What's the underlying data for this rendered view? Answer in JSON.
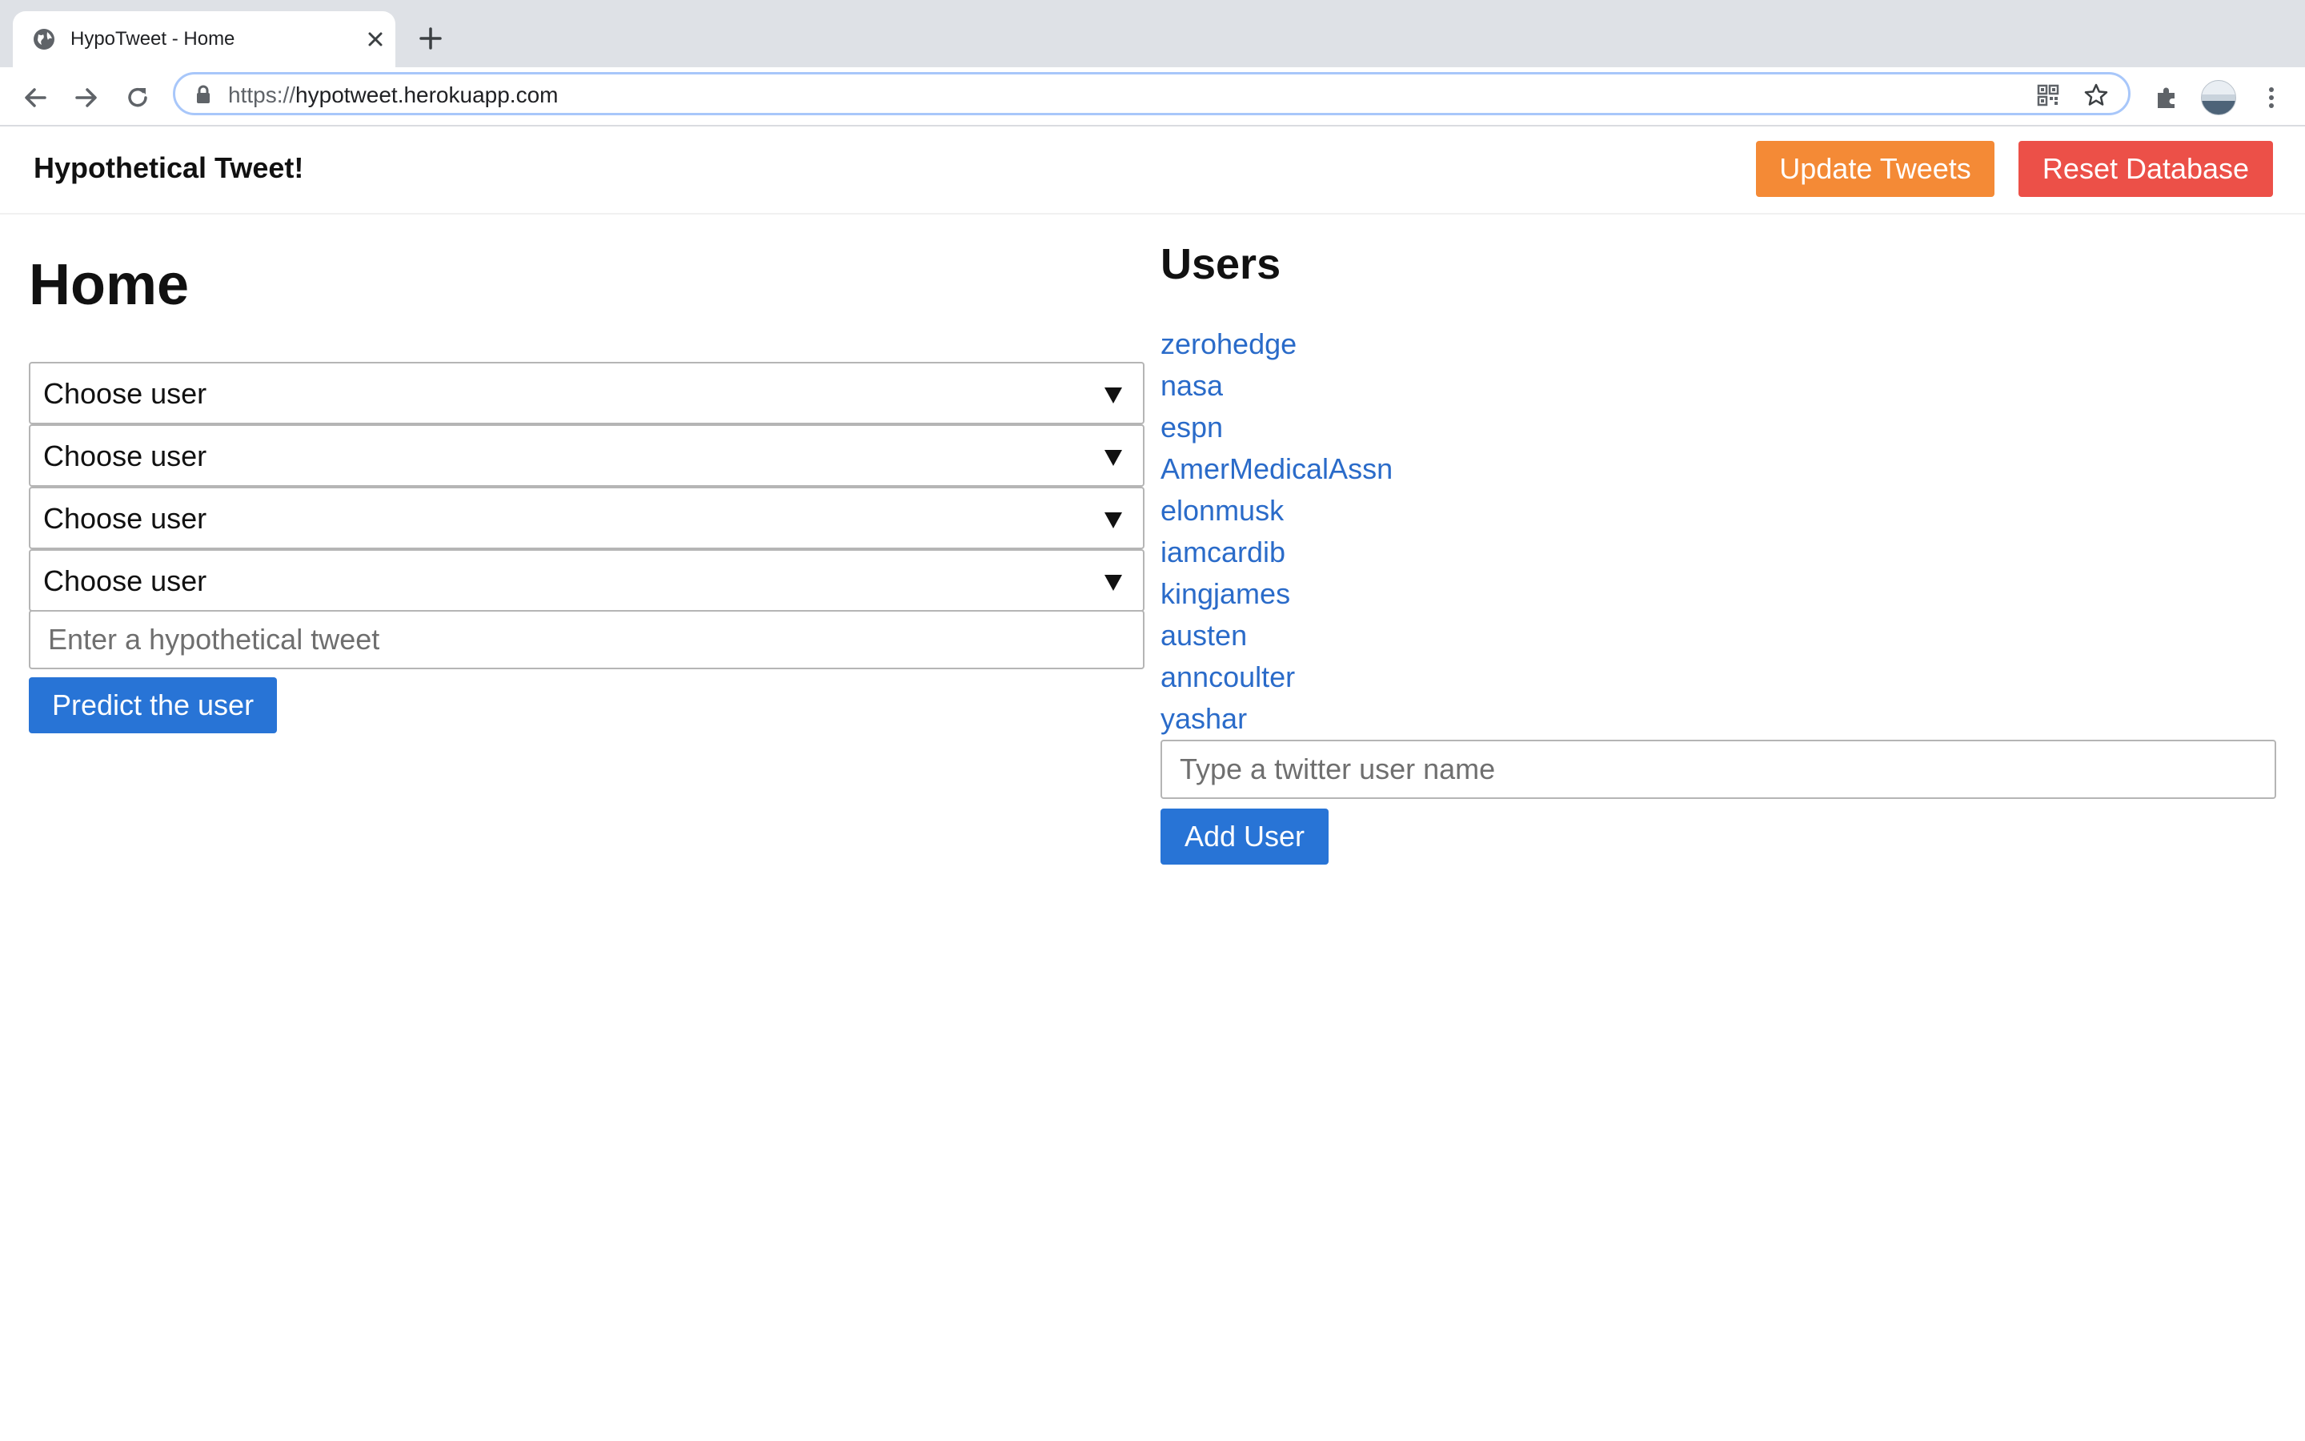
{
  "browser": {
    "tab_title": "HypoTweet - Home",
    "url_scheme": "https://",
    "url_host": "hypotweet.herokuapp.com",
    "icons": [
      "globe-icon",
      "close-icon",
      "plus-icon",
      "back-arrow-icon",
      "forward-arrow-icon",
      "reload-icon",
      "lock-icon",
      "qr-code-icon",
      "star-icon",
      "puzzle-icon",
      "kebab-menu-icon"
    ]
  },
  "navbar": {
    "brand": "Hypothetical Tweet!",
    "update_label": "Update Tweets",
    "reset_label": "Reset Database",
    "colors": {
      "update": "#f48a36",
      "reset": "#ec5048"
    }
  },
  "home": {
    "title": "Home",
    "selects": [
      {
        "value": "Choose user"
      },
      {
        "value": "Choose user"
      },
      {
        "value": "Choose user"
      },
      {
        "value": "Choose user"
      }
    ],
    "tweet_placeholder": "Enter a hypothetical tweet",
    "predict_label": "Predict the user"
  },
  "users": {
    "title": "Users",
    "list": [
      "zerohedge",
      "nasa",
      "espn",
      "AmerMedicalAssn",
      "elonmusk",
      "iamcardib",
      "kingjames",
      "austen",
      "anncoulter",
      "yashar"
    ],
    "add_placeholder": "Type a twitter user name",
    "add_label": "Add User",
    "link_color": "#2a6bc9"
  },
  "theme": {
    "primary": "#2874d6"
  }
}
